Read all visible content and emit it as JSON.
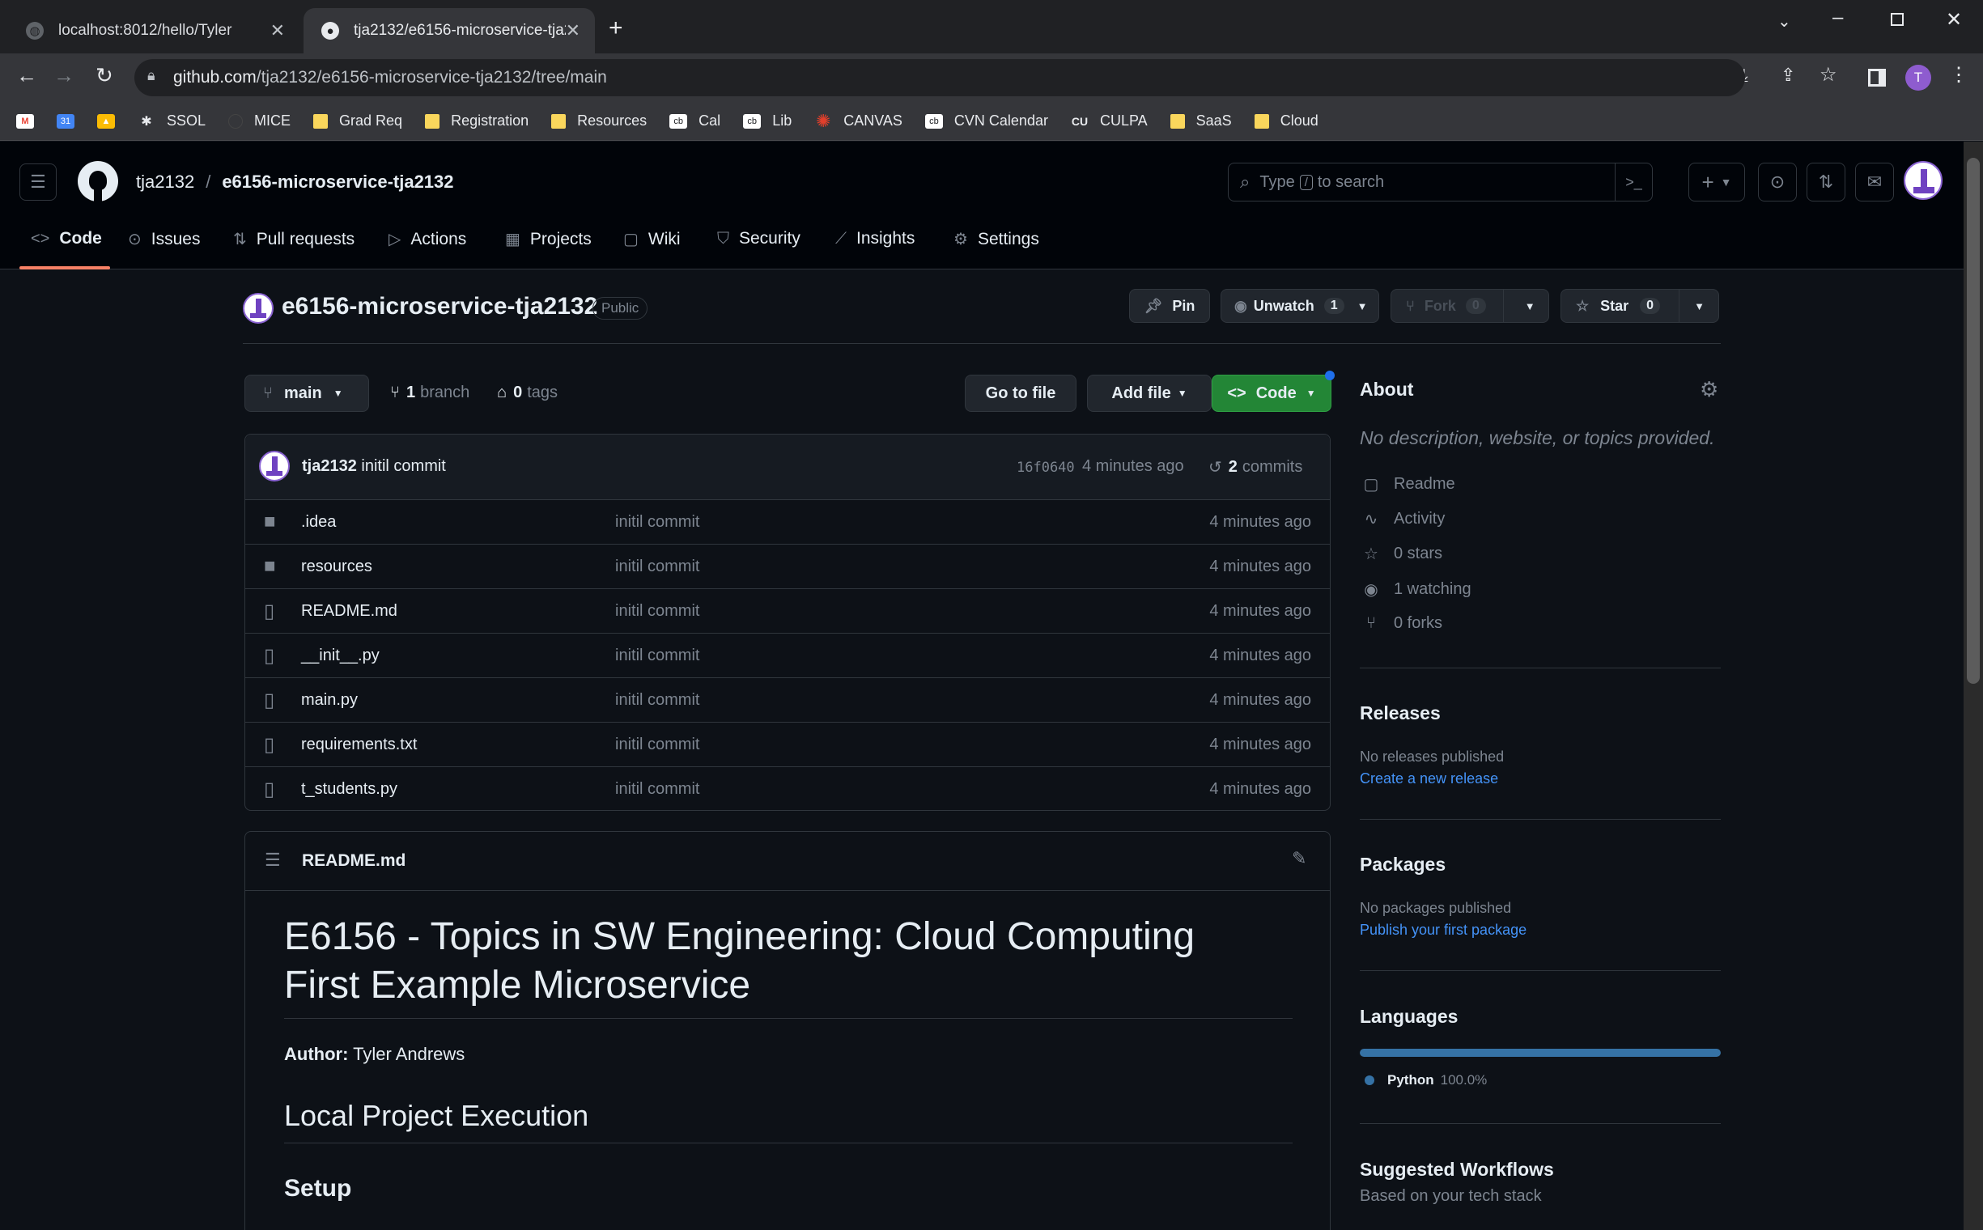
{
  "browser": {
    "tabs": [
      {
        "title": "localhost:8012/hello/Tyler"
      },
      {
        "title": "tja2132/e6156-microservice-tja2132"
      }
    ],
    "url_host": "github.com",
    "url_path": "/tja2132/e6156-microservice-tja2132/tree/main",
    "profile_initial": "T",
    "bookmarks": [
      "SSOL",
      "MICE",
      "Grad Req",
      "Registration",
      "Resources",
      "Cal",
      "Lib",
      "CANVAS",
      "CVN Calendar",
      "CULPA",
      "SaaS",
      "Cloud"
    ]
  },
  "gh": {
    "owner": "tja2132",
    "slash": "/",
    "repo": "e6156-microservice-tja2132",
    "search_placeholder_pre": "Type",
    "search_key": "/",
    "search_placeholder_post": "to search",
    "nav": [
      "Code",
      "Issues",
      "Pull requests",
      "Actions",
      "Projects",
      "Wiki",
      "Security",
      "Insights",
      "Settings"
    ]
  },
  "repo": {
    "title": "e6156-microservice-tja2132",
    "visibility": "Public",
    "pin": "Pin",
    "unwatch": "Unwatch",
    "watch_count": "1",
    "fork": "Fork",
    "fork_count": "0",
    "star": "Star",
    "star_count": "0",
    "branch_name": "main",
    "branch_count": "1",
    "branch_label": "branch",
    "tag_count": "0",
    "tag_label": "tags",
    "goto_file": "Go to file",
    "add_file": "Add file",
    "code_btn": "Code"
  },
  "commit": {
    "author": "tja2132",
    "message": "initil commit",
    "sha": "16f0640",
    "time": "4 minutes ago",
    "count": "2",
    "count_label": "commits"
  },
  "files": [
    {
      "name": ".idea",
      "type": "folder",
      "msg": "initil commit",
      "time": "4 minutes ago"
    },
    {
      "name": "resources",
      "type": "folder",
      "msg": "initil commit",
      "time": "4 minutes ago"
    },
    {
      "name": "README.md",
      "type": "file",
      "msg": "initil commit",
      "time": "4 minutes ago"
    },
    {
      "name": "__init__.py",
      "type": "file",
      "msg": "initil commit",
      "time": "4 minutes ago"
    },
    {
      "name": "main.py",
      "type": "file",
      "msg": "initil commit",
      "time": "4 minutes ago"
    },
    {
      "name": "requirements.txt",
      "type": "file",
      "msg": "initil commit",
      "time": "4 minutes ago"
    },
    {
      "name": "t_students.py",
      "type": "file",
      "msg": "initil commit",
      "time": "4 minutes ago"
    }
  ],
  "readme": {
    "filename": "README.md",
    "h1_line1": "E6156 - Topics in SW Engineering: Cloud Computing",
    "h1_line2": "First Example Microservice",
    "author_label": "Author:",
    "author_name": "Tyler Andrews",
    "h2": "Local Project Execution",
    "h3": "Setup"
  },
  "about": {
    "title": "About",
    "desc": "No description, website, or topics provided.",
    "items": [
      "Readme",
      "Activity",
      "0 stars",
      "1 watching",
      "0 forks"
    ]
  },
  "releases": {
    "title": "Releases",
    "none": "No releases published",
    "link": "Create a new release"
  },
  "packages": {
    "title": "Packages",
    "none": "No packages published",
    "link": "Publish your first package"
  },
  "languages": {
    "title": "Languages",
    "name": "Python",
    "pct": "100.0%",
    "fraction": 1.0,
    "color": "#3572A5"
  },
  "workflows": {
    "title": "Suggested Workflows",
    "sub": "Based on your tech stack"
  }
}
